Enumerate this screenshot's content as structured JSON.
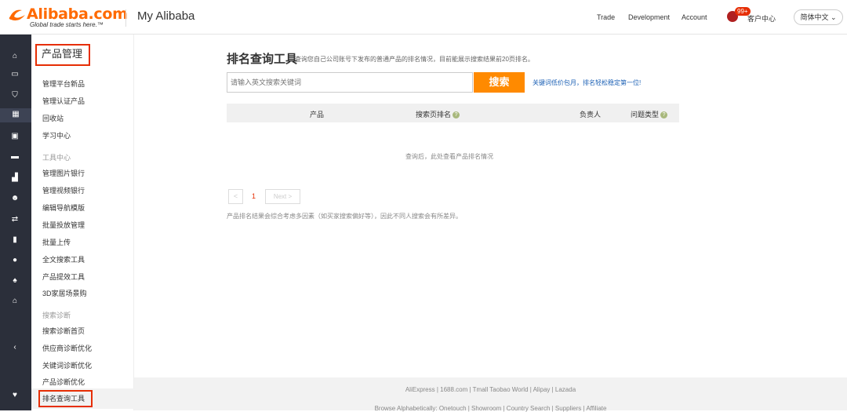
{
  "header": {
    "logo_word": "Alibaba.com",
    "logo_tagline": "Global trade starts here.™",
    "title": "My Alibaba",
    "nav": [
      "Trade",
      "Development",
      "Account"
    ],
    "badge": "99+",
    "customer_service": "客户中心",
    "language": "简体中文 ⌄"
  },
  "iconbar": {
    "icons": [
      "home-icon",
      "store-icon",
      "shield-icon",
      "grid-icon",
      "photo-icon",
      "message-icon",
      "chart-icon",
      "users-icon",
      "transfer-icon",
      "clipboard-icon",
      "globe-icon",
      "bell-icon",
      "bank-icon",
      "collapse-icon",
      "heart-icon"
    ]
  },
  "sidebar": {
    "title": "产品管理",
    "group1": [
      "管理平台新品",
      "管理认证产品",
      "回收站",
      "学习中心"
    ],
    "section_tools": "工具中心",
    "group2": [
      "管理图片银行",
      "管理视频银行",
      "编辑导航模版",
      "批量投放管理",
      "批量上传",
      "全文搜索工具",
      "产品提效工具",
      "3D家居场景购"
    ],
    "section_diag": "搜索诊断",
    "group3": [
      "搜索诊断首页",
      "供应商诊断优化",
      "关键词诊断优化",
      "产品诊断优化"
    ],
    "active": "排名查询工具"
  },
  "main": {
    "title": "排名查询工具",
    "description": "查询您自己公司账号下发布的普通产品的排名情况，目前能展示搜索结果前20页排名。",
    "search_placeholder": "请输入英文搜索关键词",
    "search_button": "搜索",
    "promo_link": "关键词低价包月，排名轻松稳定第一位!",
    "columns": [
      "产品",
      "搜索页排名",
      "负责人",
      "问题类型"
    ],
    "empty_text": "查询后，此处查看产品排名情况",
    "pager": {
      "prev": "<",
      "page": "1",
      "next": "Next >"
    },
    "note": "产品排名结果会综合考虑多因素（如买家搜索偏好等），因此不同人搜索会有所差异。"
  },
  "footer": {
    "links": "AliExpress | 1688.com | Tmall Taobao World | Alipay | Lazada",
    "links2": "Browse Alphabetically: Onetouch | Showroom | Country Search | Suppliers | Affiliate"
  },
  "colors": {
    "accent": "#ff6a00",
    "sidebar_bg": "#2b2f3a",
    "highlight_red": "#e62e04",
    "search_btn": "#ff8a00"
  }
}
